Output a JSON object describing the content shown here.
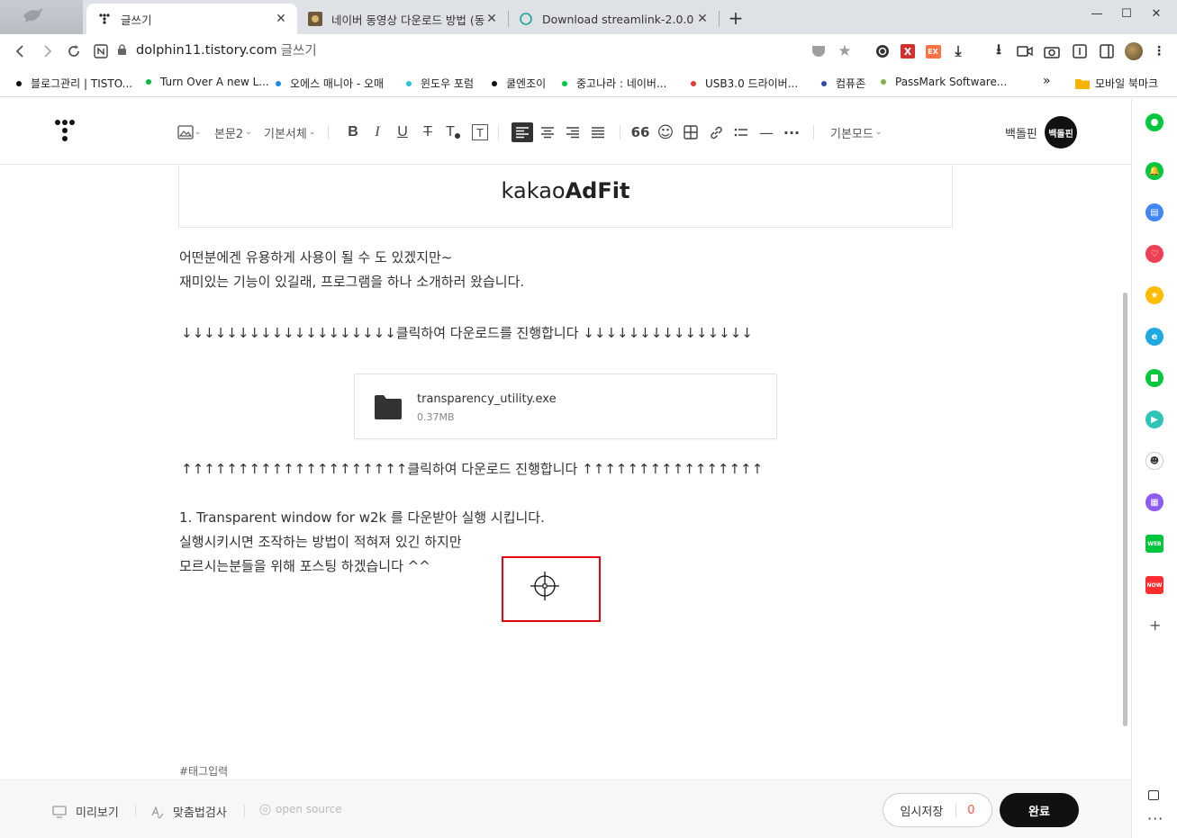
{
  "browser": {
    "tabs": [
      {
        "title": "글쓰기",
        "active": true
      },
      {
        "title": "네이버 동영상 다운로드 방법 (동",
        "active": false
      },
      {
        "title": "Download streamlink-2.0.0.exe",
        "active": false
      }
    ],
    "new_tab": "+",
    "window_controls": {
      "minimize": "—",
      "maximize": "☐",
      "close": "✕"
    },
    "address": {
      "host": "dolphin11.tistory.com",
      "path": "글쓰기"
    },
    "extensions": [
      {
        "name": "pocket-icon",
        "color": "#9e9e9e"
      },
      {
        "name": "star-icon",
        "color": "#9e9e9e"
      },
      {
        "name": "ext-g-icon",
        "color": "#333333"
      },
      {
        "name": "ext-x-icon",
        "color": "#d32f2f"
      },
      {
        "name": "ext-ex-icon",
        "color": "#ff7043"
      },
      {
        "name": "download-arrow-icon",
        "color": "#333333"
      },
      {
        "name": "download-icon",
        "color": "#333333"
      },
      {
        "name": "video-icon",
        "color": "#333333"
      },
      {
        "name": "camera-icon",
        "color": "#333333"
      },
      {
        "name": "reader-icon",
        "color": "#333333"
      },
      {
        "name": "sidebar-icon",
        "color": "#333333"
      }
    ],
    "bookmarks": [
      {
        "label": "블로그관리 | TISTO...",
        "color": "#111111"
      },
      {
        "label": "Turn Over A new L...",
        "color": "#00b843"
      },
      {
        "label": "오에스 매니아 - 오매",
        "color": "#1e88e5"
      },
      {
        "label": "윈도우 포럼",
        "color": "#26c6da"
      },
      {
        "label": "쿨엔조이",
        "color": "#111111"
      },
      {
        "label": "중고나라 : 네이버...",
        "color": "#00c73c"
      },
      {
        "label": "USB3.0 드라이버...",
        "color": "#e53935"
      },
      {
        "label": "컴퓨존",
        "color": "#3949ab"
      },
      {
        "label": "PassMark Software...",
        "color": "#7cb342"
      }
    ],
    "bookmarks_overflow": "»",
    "mobile_bookmarks": "모바일 북마크"
  },
  "editor": {
    "toolbar": {
      "image_label": "",
      "paragraph_style": "본문2",
      "font": "기본서체",
      "bold": "B",
      "italic": "I",
      "underline": "U",
      "strikethrough": "T",
      "text_color": "T",
      "text_bg": "T",
      "quote": "66",
      "emoji": "☺",
      "table": "⊞",
      "link": "🔗",
      "list": "☰",
      "divider": "—",
      "more": "···",
      "mode": "기본모드"
    },
    "user": {
      "name": "백돌핀",
      "avatar_text": "백돌핀"
    }
  },
  "content": {
    "ad": {
      "prefix": "kakao",
      "brand": "AdFit"
    },
    "intro_line1": "어떤분에겐 유용하게 사용이 될 수 도 있겠지만~",
    "intro_line2": "재미있는 기능이 있길래, 프로그램을 하나 소개하러 왔습니다.",
    "down_line": "↓↓↓↓↓↓↓↓↓↓↓↓↓↓↓↓↓↓↓클릭하여 다운로드를 진행합니다 ↓↓↓↓↓↓↓↓↓↓↓↓↓↓↓",
    "file": {
      "name": "transparency_utility.exe",
      "size": "0.37MB"
    },
    "up_line": "↑↑↑↑↑↑↑↑↑↑↑↑↑↑↑↑↑↑↑↑클릭하여 다운로드 진행합니다 ↑↑↑↑↑↑↑↑↑↑↑↑↑↑↑↑",
    "step_line1": "1. Transparent window for w2k 를 다운받아 실행 시킵니다.",
    "step_line2": "실행시키시면 조작하는 방법이 적혀져 있긴 하지만",
    "step_line3": "모르시는분들을 위해 포스팅 하겠습니다 ^^",
    "tag_placeholder": "#태그입력"
  },
  "bottom": {
    "preview": "미리보기",
    "spellcheck": "맞춤법검사",
    "open_source": "open source",
    "save_draft": "임시저장",
    "draft_count": "0",
    "done": "완료"
  },
  "side_panel": {
    "icons": [
      {
        "name": "green-circle-icon",
        "color": "#00c73c"
      },
      {
        "name": "bell-icon",
        "color": "#00c73c"
      },
      {
        "name": "briefcase-icon",
        "color": "#4285f4"
      },
      {
        "name": "pocket-red-icon",
        "color": "#ef3f56"
      },
      {
        "name": "star-yellow-icon",
        "color": "#ffbb00"
      },
      {
        "name": "edge-icon",
        "color": "#1fa9e2"
      },
      {
        "name": "square-green-icon",
        "color": "#00c73c"
      },
      {
        "name": "play-green-icon",
        "color": "#2ec4b6"
      },
      {
        "name": "character-icon",
        "color": "#8bc34a"
      },
      {
        "name": "calendar-icon",
        "color": "#8e5cf2"
      },
      {
        "name": "webtoon-icon",
        "color": "#00c73c"
      },
      {
        "name": "now-icon",
        "color": "#ff2d2d"
      }
    ],
    "add": "+",
    "more": "···"
  }
}
